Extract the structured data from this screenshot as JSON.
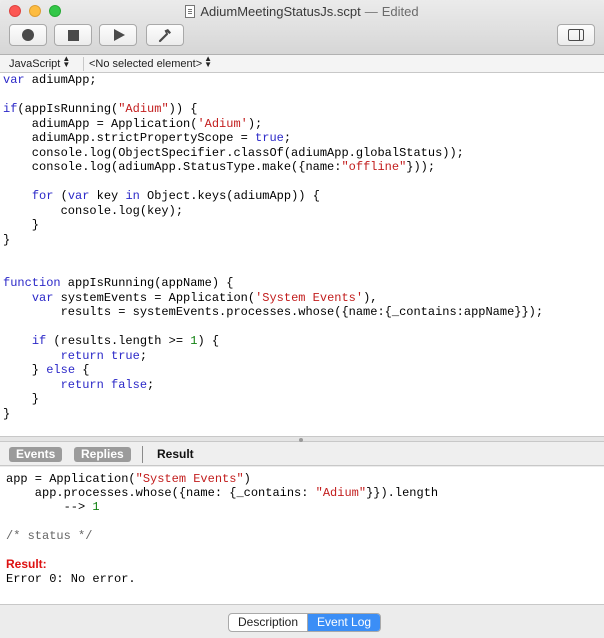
{
  "window": {
    "title": "AdiumMeetingStatusJs.scpt",
    "separator": "—",
    "status": "Edited"
  },
  "navbar": {
    "language": "JavaScript",
    "element": "<No selected element>"
  },
  "tabs": {
    "events": "Events",
    "replies": "Replies",
    "result": "Result"
  },
  "output": {
    "lines": [
      "app = Application(\"System Events\")",
      "    app.processes.whose({name: {_contains: \"Adium\"}}).length",
      "        --> 1",
      "",
      "/* status */",
      ""
    ],
    "result_label": "Result:",
    "result_text": "Error 0: No error."
  },
  "bottom": {
    "description": "Description",
    "event_log": "Event Log"
  },
  "colors": {
    "keyword": "#2b28c8",
    "string": "#c21d1d",
    "number": "#138213",
    "result_label": "#dd1111",
    "active_segment": "#3b8ef6"
  },
  "code_lines": [
    [
      [
        "kw",
        "var"
      ],
      [
        "t",
        " adiumApp;"
      ]
    ],
    [],
    [
      [
        "kw",
        "if"
      ],
      [
        "t",
        "(appIsRunning("
      ],
      [
        "str",
        "\"Adium\""
      ],
      [
        "t",
        ")) {"
      ]
    ],
    [
      [
        "t",
        "    adiumApp = Application("
      ],
      [
        "str",
        "'Adium'"
      ],
      [
        "t",
        ");"
      ]
    ],
    [
      [
        "t",
        "    adiumApp.strictPropertyScope = "
      ],
      [
        "kw",
        "true"
      ],
      [
        "t",
        ";"
      ]
    ],
    [
      [
        "t",
        "    console.log(ObjectSpecifier.classOf(adiumApp.globalStatus));"
      ]
    ],
    [
      [
        "t",
        "    console.log(adiumApp.StatusType.make({name:"
      ],
      [
        "str",
        "\"offline\""
      ],
      [
        "t",
        "}));"
      ]
    ],
    [],
    [
      [
        "t",
        "    "
      ],
      [
        "kw",
        "for"
      ],
      [
        "t",
        " ("
      ],
      [
        "kw",
        "var"
      ],
      [
        "t",
        " key "
      ],
      [
        "kw",
        "in"
      ],
      [
        "t",
        " Object.keys(adiumApp)) {"
      ]
    ],
    [
      [
        "t",
        "        console.log(key);"
      ]
    ],
    [
      [
        "t",
        "    }"
      ]
    ],
    [
      [
        "t",
        "}"
      ]
    ],
    [],
    [],
    [
      [
        "kw",
        "function"
      ],
      [
        "t",
        " appIsRunning(appName) {"
      ]
    ],
    [
      [
        "t",
        "    "
      ],
      [
        "kw",
        "var"
      ],
      [
        "t",
        " systemEvents = Application("
      ],
      [
        "str",
        "'System Events'"
      ],
      [
        "t",
        "),"
      ]
    ],
    [
      [
        "t",
        "        results = systemEvents.processes.whose({name:{_contains:appName}});"
      ]
    ],
    [],
    [
      [
        "t",
        "    "
      ],
      [
        "kw",
        "if"
      ],
      [
        "t",
        " (results.length >= "
      ],
      [
        "num",
        "1"
      ],
      [
        "t",
        ") {"
      ]
    ],
    [
      [
        "t",
        "        "
      ],
      [
        "kw",
        "return"
      ],
      [
        "t",
        " "
      ],
      [
        "kw",
        "true"
      ],
      [
        "t",
        ";"
      ]
    ],
    [
      [
        "t",
        "    } "
      ],
      [
        "kw",
        "else"
      ],
      [
        "t",
        " {"
      ]
    ],
    [
      [
        "t",
        "        "
      ],
      [
        "kw",
        "return"
      ],
      [
        "t",
        " "
      ],
      [
        "kw",
        "false"
      ],
      [
        "t",
        ";"
      ]
    ],
    [
      [
        "t",
        "    }"
      ]
    ],
    [
      [
        "t",
        "}"
      ]
    ]
  ]
}
